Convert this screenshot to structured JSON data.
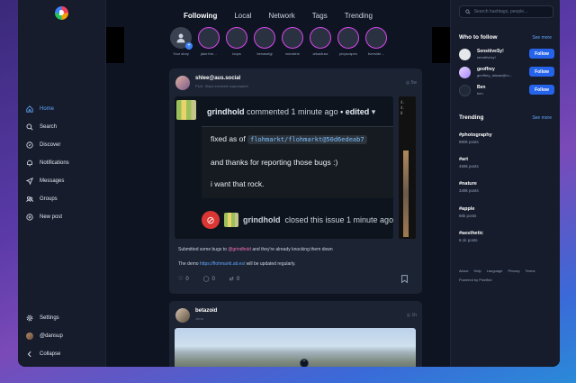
{
  "sidebar": {
    "logo": "pixelfed-logo",
    "items": [
      {
        "label": "Home",
        "icon": "home-icon",
        "active": true
      },
      {
        "label": "Search",
        "icon": "search-icon"
      },
      {
        "label": "Discover",
        "icon": "compass-icon"
      },
      {
        "label": "Notifications",
        "icon": "bell-icon"
      },
      {
        "label": "Messages",
        "icon": "send-icon"
      },
      {
        "label": "Groups",
        "icon": "users-icon"
      },
      {
        "label": "New post",
        "icon": "plus-circle-icon"
      }
    ],
    "bottom": [
      {
        "label": "Settings",
        "icon": "gear-icon"
      },
      {
        "label": "@dansup",
        "icon": "avatar"
      },
      {
        "label": "Collapse",
        "icon": "chevron-left-icon"
      }
    ]
  },
  "tabs": [
    "Following",
    "Local",
    "Network",
    "Tags",
    "Trending"
  ],
  "active_tab": "Following",
  "stories": {
    "you_label": "Your story",
    "items": [
      "jake.the…",
      "loops",
      "benaselgi",
      "monstern",
      "arkadiusz",
      "pixyscapes",
      "liverside…"
    ]
  },
  "post1": {
    "author": "shlee@aus.social",
    "subtitle": "PUA. Ships involved unprompted",
    "time": "5w",
    "screenshot": {
      "author": "grindhold",
      "action": "commented 1 minute ago",
      "edited": "• edited",
      "lines": [
        "fixed as of",
        "and thanks for reporting those bugs :)",
        "i want that rock."
      ],
      "code": "flohmarkt/flohmarkt@50d6edeab7",
      "closed_author": "grindhold",
      "closed_text": "closed this issue 1 minute ago"
    },
    "text_1a": "Submitted some bugs to ",
    "text_1_mention": "@grindhold",
    "text_1b": " and they're already knocking them down",
    "text_2a": "The demo ",
    "text_2_link": "https://flohmarkt.ati.es/",
    "text_2b": " will be updated regularly.",
    "likes": "0",
    "comments": "0",
    "shares": "0"
  },
  "post2": {
    "author": "betazoid",
    "subtitle": "Jena",
    "time": "1h"
  },
  "right": {
    "search_placeholder": "Search hashtags, people…",
    "who_to_follow": "Who to follow",
    "see_more": "See more",
    "follow_label": "Follow",
    "suggestions": [
      {
        "name": "SensitiveSy!",
        "handle": "sensitivesy!"
      },
      {
        "name": "geoffrey",
        "handle": "geoffrey_taiwan@m…"
      },
      {
        "name": "Ben",
        "handle": "ben"
      }
    ],
    "trending_title": "Trending",
    "trending": [
      {
        "tag": "#photography",
        "count": "890k posts"
      },
      {
        "tag": "#art",
        "count": "459k posts"
      },
      {
        "tag": "#nature",
        "count": "349k posts"
      },
      {
        "tag": "#apple",
        "count": "66k posts"
      },
      {
        "tag": "#aesthetic",
        "count": "6.1k posts"
      }
    ],
    "footer": [
      "About",
      "Help",
      "Language",
      "Privacy",
      "Terms"
    ],
    "powered": "Powered by Pixelfed"
  },
  "colors": {
    "accent": "#60a5fa",
    "button": "#2563eb",
    "story_ring": "#d946ef",
    "background": "#0f1422"
  }
}
